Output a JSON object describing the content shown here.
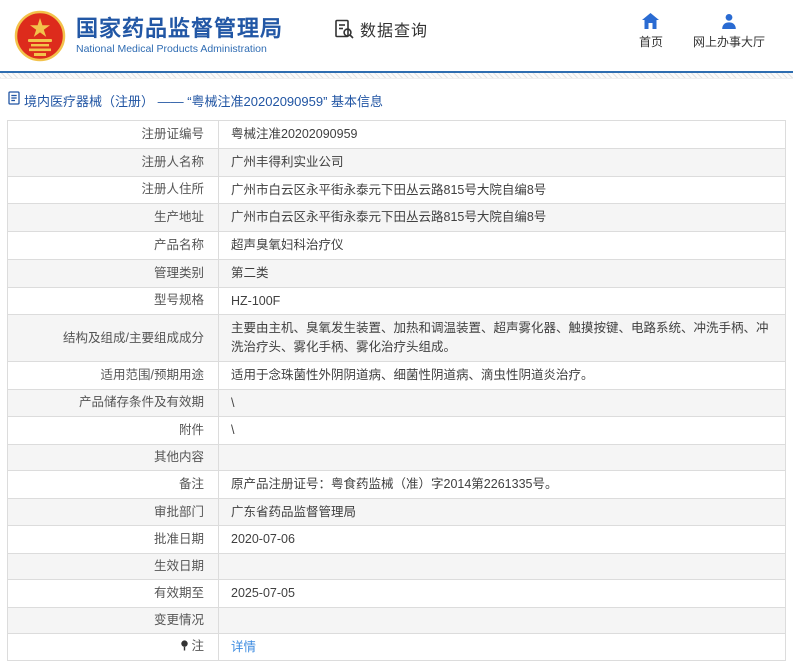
{
  "header": {
    "title": "国家药品监督管理局",
    "subtitle": "National Medical Products Administration",
    "emblem_icon": "china-national-emblem",
    "query": {
      "label": "数据查询",
      "icon": "document-search-icon"
    },
    "nav": [
      {
        "label": "首页",
        "icon": "home-icon"
      },
      {
        "label": "网上办事大厅",
        "icon": "user-icon"
      }
    ],
    "colors": {
      "title_blue": "#2257a5",
      "icon_blue": "#2a6bd2",
      "divider_blue": "#2e6db0",
      "emblem_red": "#dd2b1c",
      "emblem_gold": "#f3c24b"
    }
  },
  "breadcrumb": {
    "icon": "document-icon",
    "text": "境内医疗器械（注册） —— “粤械注准20202090959” 基本信息"
  },
  "table": {
    "colors": {
      "stripe": "#f5f5f5",
      "border": "#dcdcdc",
      "link": "#3c8be0"
    },
    "rows": [
      {
        "label": "注册证编号",
        "value": "粤械注准20202090959"
      },
      {
        "label": "注册人名称",
        "value": "广州丰得利实业公司"
      },
      {
        "label": "注册人住所",
        "value": "广州市白云区永平街永泰元下田丛云路815号大院自编8号"
      },
      {
        "label": "生产地址",
        "value": "广州市白云区永平街永泰元下田丛云路815号大院自编8号"
      },
      {
        "label": "产品名称",
        "value": "超声臭氧妇科治疗仪"
      },
      {
        "label": "管理类别",
        "value": "第二类"
      },
      {
        "label": "型号规格",
        "value": "HZ-100F"
      },
      {
        "label": "结构及组成/主要组成成分",
        "value": "主要由主机、臭氧发生装置、加热和调温装置、超声雾化器、触摸按键、电路系统、冲洗手柄、冲洗治疗头、雾化手柄、雾化治疗头组成。"
      },
      {
        "label": "适用范围/预期用途",
        "value": "适用于念珠菌性外阴阴道病、细菌性阴道病、滴虫性阴道炎治疗。"
      },
      {
        "label": "产品储存条件及有效期",
        "value": "\\"
      },
      {
        "label": "附件",
        "value": "\\"
      },
      {
        "label": "其他内容",
        "value": ""
      },
      {
        "label": "备注",
        "value": "原产品注册证号：粤食药监械（准）字2014第2261335号。"
      },
      {
        "label": "审批部门",
        "value": "广东省药品监督管理局"
      },
      {
        "label": "批准日期",
        "value": "2020-07-06"
      },
      {
        "label": "生效日期",
        "value": ""
      },
      {
        "label": "有效期至",
        "value": "2025-07-05"
      },
      {
        "label": "变更情况",
        "value": ""
      },
      {
        "label": "注",
        "value": "详情",
        "icon": "pin-icon",
        "value_is_link": true
      }
    ]
  }
}
